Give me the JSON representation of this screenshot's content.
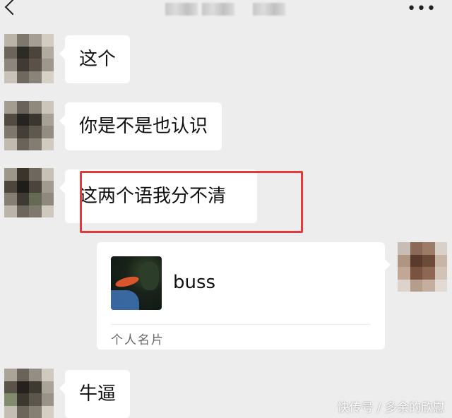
{
  "header": {
    "more_label": "•••"
  },
  "messages": [
    {
      "sender": "other",
      "text": "这个"
    },
    {
      "sender": "other",
      "text": "你是不是也认识"
    },
    {
      "sender": "other",
      "text": "这两个语我分不清"
    },
    {
      "sender": "other",
      "text": "牛逼"
    }
  ],
  "contact_card": {
    "name": "buss",
    "label": "个人名片"
  },
  "watermark": "快传号 / 多余的欣慰",
  "colors": {
    "background": "#ededed",
    "bubble": "#ffffff",
    "highlight_box": "#e23a3a"
  }
}
